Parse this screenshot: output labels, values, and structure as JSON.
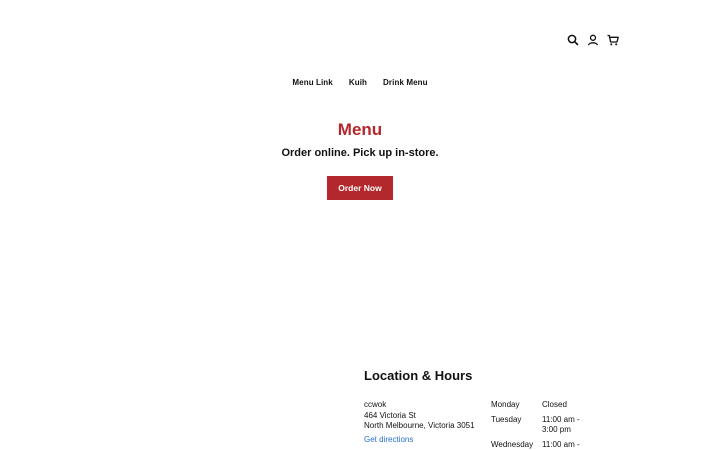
{
  "header": {
    "icons": [
      "search-icon",
      "account-icon",
      "cart-icon"
    ]
  },
  "nav": {
    "items": [
      "Menu Link",
      "Kuih",
      "Drink Menu"
    ]
  },
  "hero": {
    "title": "Menu",
    "subtitle": "Order online. Pick up in-store.",
    "order_button": "Order Now"
  },
  "location": {
    "title": "Location & Hours",
    "name": "ccwok",
    "street": "464 Victoria St",
    "city": "North Melbourne, Victoria 3051",
    "directions": "Get directions",
    "hours": [
      {
        "day": "Monday",
        "time": "Closed"
      },
      {
        "day": "Tuesday",
        "time": "11:00 am - 3:00 pm"
      },
      {
        "day": "Wednesday",
        "time": "11:00 am -"
      }
    ]
  },
  "colors": {
    "accent": "#b3282d",
    "link": "#2a6fd6"
  }
}
